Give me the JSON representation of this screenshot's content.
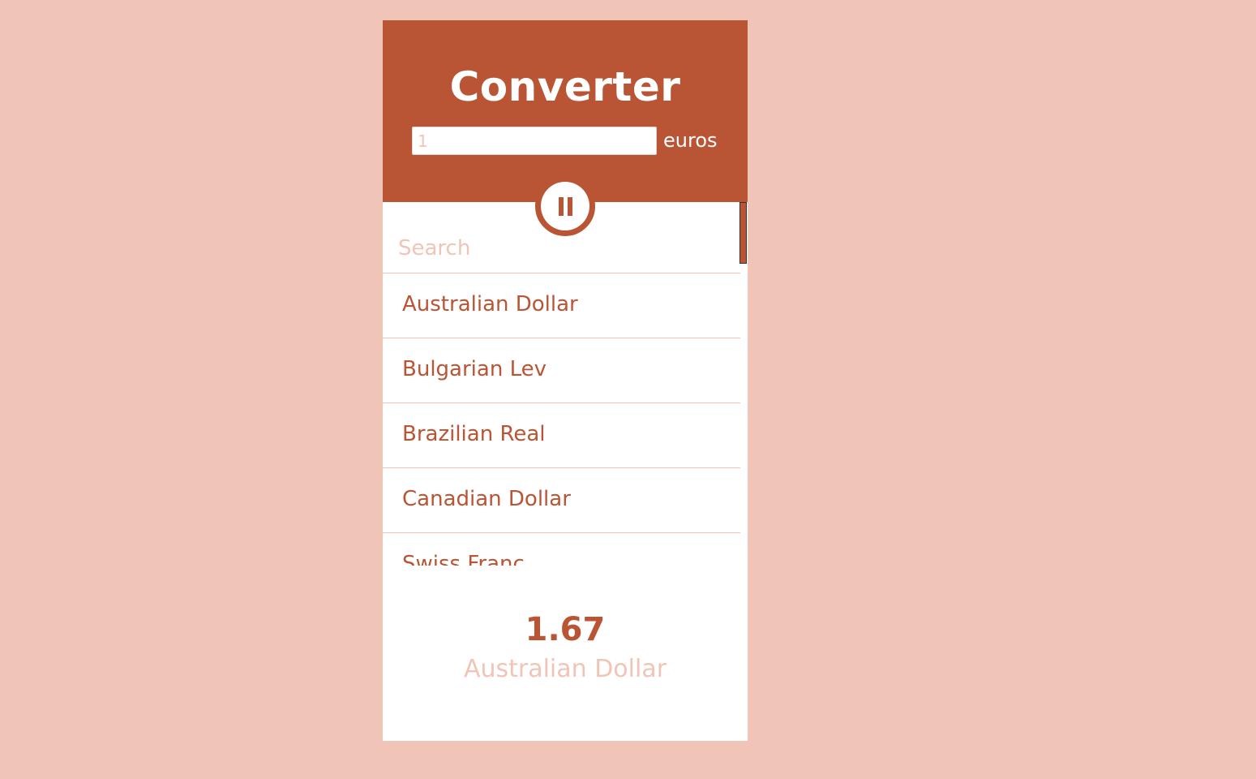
{
  "header": {
    "title": "Converter",
    "amount_value": "1",
    "unit_label": "euros"
  },
  "toggle": {
    "icon": "pause-icon"
  },
  "search": {
    "placeholder": "Search"
  },
  "currencies": [
    "Australian Dollar",
    "Bulgarian Lev",
    "Brazilian Real",
    "Canadian Dollar",
    "Swiss Franc"
  ],
  "result": {
    "value": "1.67",
    "currency": "Australian Dollar"
  },
  "colors": {
    "background": "#f0c5b7",
    "accent": "#b95534",
    "card": "#ffffff"
  }
}
